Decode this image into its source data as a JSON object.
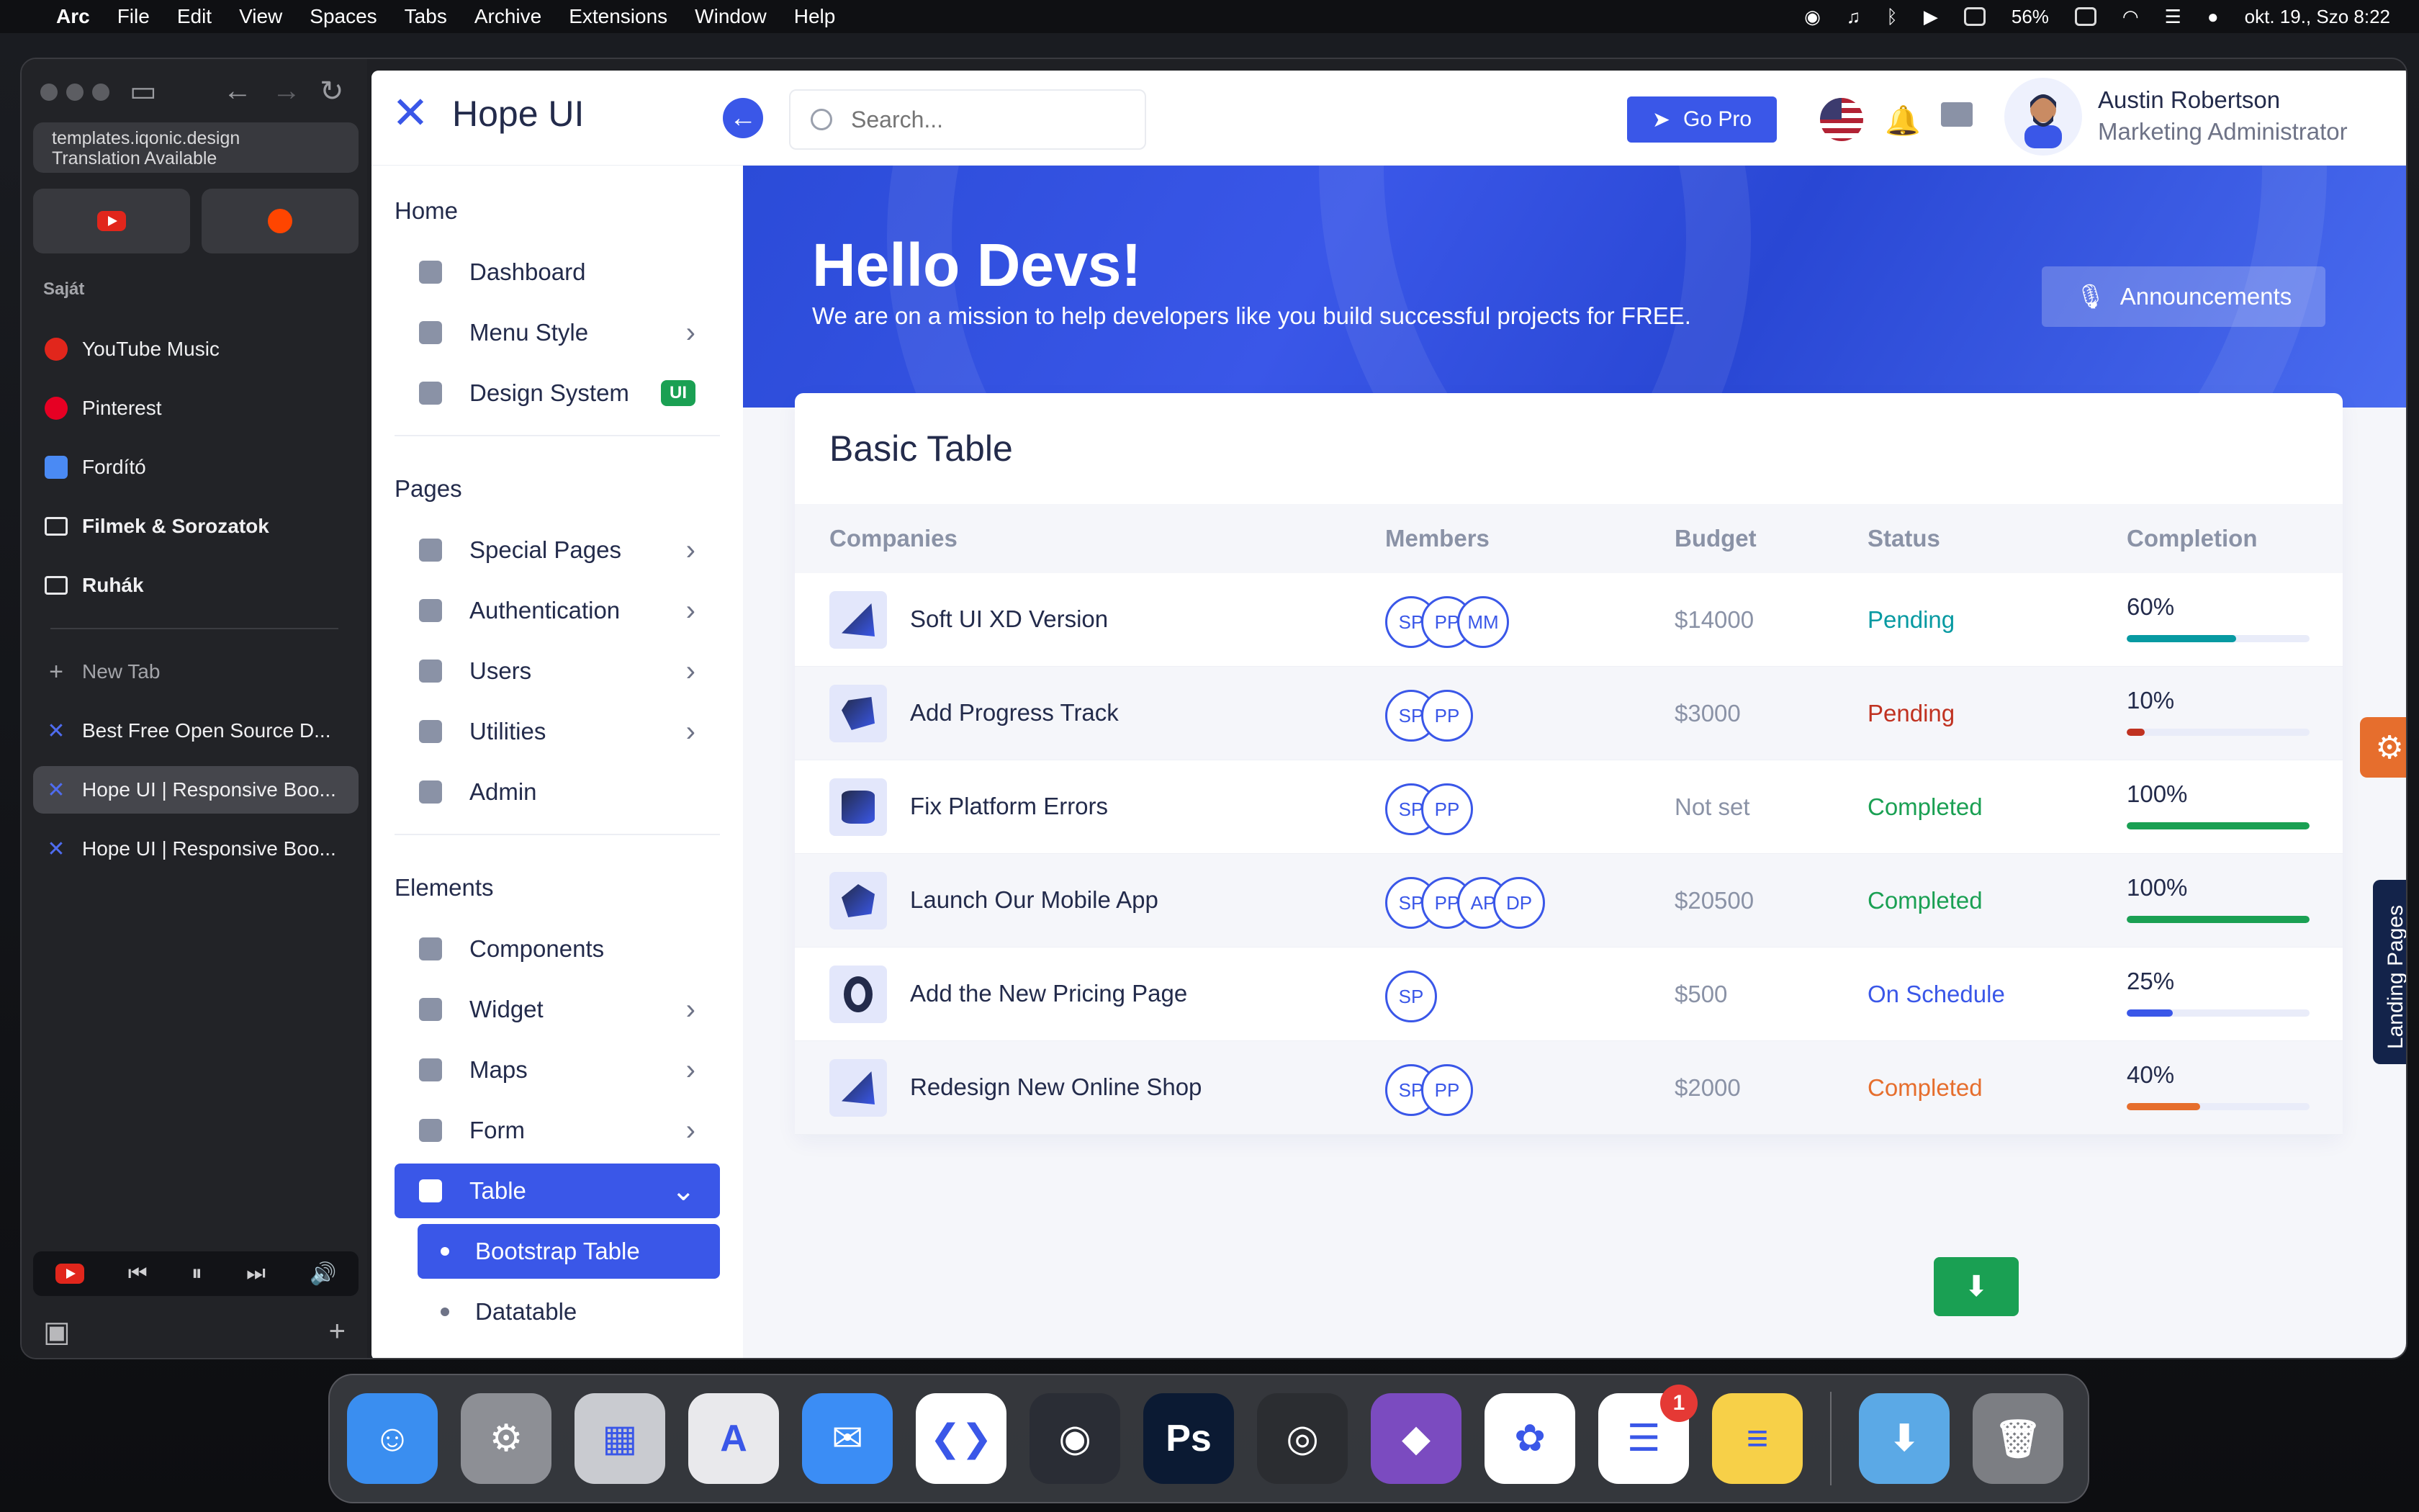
{
  "menubar": {
    "app": "Arc",
    "items": [
      "File",
      "Edit",
      "View",
      "Spaces",
      "Tabs",
      "Archive",
      "Extensions",
      "Window",
      "Help"
    ],
    "battery": "56%",
    "datetime": "okt. 19., Szo 8:22"
  },
  "arc": {
    "url_line1": "templates.iqonic.design",
    "url_line2": "Translation Available",
    "space_label": "Saját",
    "pinned": [
      {
        "label": "YouTube Music",
        "icon": "youtube-music-icon"
      },
      {
        "label": "Pinterest",
        "icon": "pinterest-icon"
      },
      {
        "label": "Fordító",
        "icon": "translate-icon"
      },
      {
        "label": "Filmek & Sorozatok",
        "icon": "folder-icon"
      },
      {
        "label": "Ruhák",
        "icon": "folder-icon"
      }
    ],
    "new_tab": "New Tab",
    "tabs": [
      {
        "label": "Best Free Open Source D..."
      },
      {
        "label": "Hope UI | Responsive Boo..."
      },
      {
        "label": "Hope UI | Responsive Boo..."
      }
    ]
  },
  "page": {
    "brand": "Hope UI",
    "search_placeholder": "Search...",
    "go_pro": "Go Pro",
    "user_name": "Austin Robertson",
    "user_role": "Marketing Administrator",
    "nav": {
      "home": "Home",
      "dashboard": "Dashboard",
      "menu_style": "Menu Style",
      "design_system": "Design System",
      "ui_badge": "UI",
      "pages": "Pages",
      "special_pages": "Special Pages",
      "authentication": "Authentication",
      "users": "Users",
      "utilities": "Utilities",
      "admin": "Admin",
      "elements": "Elements",
      "components": "Components",
      "widget": "Widget",
      "maps": "Maps",
      "form": "Form",
      "table": "Table",
      "bootstrap_table": "Bootstrap Table",
      "datatable": "Datatable"
    },
    "hero": {
      "title": "Hello Devs!",
      "subtitle": "We are on a mission to help developers like you build successful projects for FREE.",
      "announcements": "Announcements"
    },
    "table": {
      "title": "Basic Table",
      "headers": [
        "Companies",
        "Members",
        "Budget",
        "Status",
        "Completion"
      ],
      "rows": [
        {
          "company": "Soft UI XD Version",
          "members": [
            "SP",
            "PP",
            "MM"
          ],
          "budget": "$14000",
          "status": "Pending",
          "status_color": "#079aa2",
          "completion": "60%",
          "progress": 0.6,
          "bar_color": "#079aa2",
          "shape": "cone"
        },
        {
          "company": "Add Progress Track",
          "members": [
            "SP",
            "PP"
          ],
          "budget": "$3000",
          "status": "Pending",
          "status_color": "#c03221",
          "completion": "10%",
          "progress": 0.1,
          "bar_color": "#c03221",
          "shape": "cube"
        },
        {
          "company": "Fix Platform Errors",
          "members": [
            "SP",
            "PP"
          ],
          "budget": "Not set",
          "status": "Completed",
          "status_color": "#1aa053",
          "completion": "100%",
          "progress": 1.0,
          "bar_color": "#1aa053",
          "shape": "cyl"
        },
        {
          "company": "Launch Our Mobile App",
          "members": [
            "SP",
            "PP",
            "AP",
            "DP"
          ],
          "budget": "$20500",
          "status": "Completed",
          "status_color": "#1aa053",
          "completion": "100%",
          "progress": 1.0,
          "bar_color": "#1aa053",
          "shape": "poly"
        },
        {
          "company": "Add the New Pricing Page",
          "members": [
            "SP"
          ],
          "budget": "$500",
          "status": "On Schedule",
          "status_color": "#3a57e8",
          "completion": "25%",
          "progress": 0.25,
          "bar_color": "#3a57e8",
          "shape": "ring"
        },
        {
          "company": "Redesign New Online Shop",
          "members": [
            "SP",
            "PP"
          ],
          "budget": "$2000",
          "status": "Completed",
          "status_color": "#e66e2d",
          "completion": "40%",
          "progress": 0.4,
          "bar_color": "#e66e2d",
          "shape": "cone"
        }
      ]
    },
    "landing_pages": "Landing Pages"
  },
  "dock": {
    "apps": [
      {
        "name": "Finder",
        "color": "#3a8ef0",
        "glyph": "☺"
      },
      {
        "name": "System Settings",
        "color": "#8d8f95",
        "glyph": "⚙"
      },
      {
        "name": "Launchpad",
        "color": "#c9cbd0",
        "glyph": "▦"
      },
      {
        "name": "Affinity Designer",
        "color": "#e9e9ec",
        "glyph": "A"
      },
      {
        "name": "Mail",
        "color": "#3b8df5",
        "glyph": "✉"
      },
      {
        "name": "Visual Studio Code",
        "color": "#ffffff",
        "glyph": "❮❯"
      },
      {
        "name": "DaVinci Resolve",
        "color": "#2a2d35",
        "glyph": "◉"
      },
      {
        "name": "Photoshop",
        "color": "#0b1a33",
        "glyph": "Ps"
      },
      {
        "name": "Blender",
        "color": "#2b2d31",
        "glyph": "◎"
      },
      {
        "name": "GitHub Desktop",
        "color": "#7b4bc0",
        "glyph": "◆"
      },
      {
        "name": "Photos",
        "color": "#ffffff",
        "glyph": "✿"
      },
      {
        "name": "Reminders",
        "color": "#ffffff",
        "glyph": "☰",
        "badge": "1"
      },
      {
        "name": "Notes",
        "color": "#f7d048",
        "glyph": "≡"
      },
      {
        "name": "Downloads",
        "color": "#5ba9e6",
        "glyph": "⬇"
      },
      {
        "name": "Trash",
        "color": "#7c7e83",
        "glyph": "🗑"
      }
    ]
  }
}
